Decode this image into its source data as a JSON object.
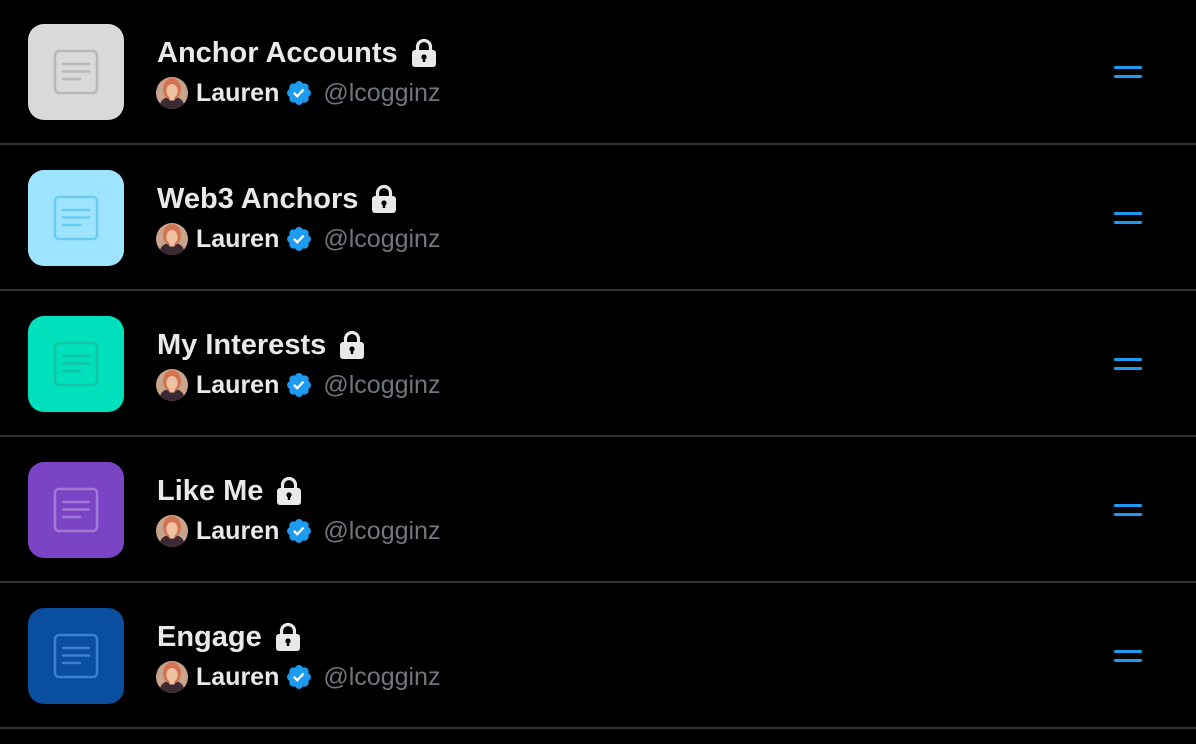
{
  "lists": [
    {
      "title": "Anchor Accounts",
      "owner_name": "Lauren",
      "handle": "@lcogginz",
      "thumb_bg": "#d9d9d9",
      "thumb_icon_color": "#b8b8b8",
      "lock_icon": "lock-icon",
      "verified_icon": "verified-badge-icon",
      "drag_icon": "drag-handle-icon"
    },
    {
      "title": "Web3 Anchors",
      "owner_name": "Lauren",
      "handle": "@lcogginz",
      "thumb_bg": "#9fe4ff",
      "thumb_icon_color": "#6ccbf0",
      "lock_icon": "lock-icon",
      "verified_icon": "verified-badge-icon",
      "drag_icon": "drag-handle-icon"
    },
    {
      "title": "My Interests",
      "owner_name": "Lauren",
      "handle": "@lcogginz",
      "thumb_bg": "#00e0bd",
      "thumb_icon_color": "#14c2a4",
      "lock_icon": "lock-icon",
      "verified_icon": "verified-badge-icon",
      "drag_icon": "drag-handle-icon"
    },
    {
      "title": "Like Me",
      "owner_name": "Lauren",
      "handle": "@lcogginz",
      "thumb_bg": "#7a44c4",
      "thumb_icon_color": "#a07ad8",
      "lock_icon": "lock-icon",
      "verified_icon": "verified-badge-icon",
      "drag_icon": "drag-handle-icon"
    },
    {
      "title": "Engage",
      "owner_name": "Lauren",
      "handle": "@lcogginz",
      "thumb_bg": "#0a4ea0",
      "thumb_icon_color": "#3d7fd0",
      "lock_icon": "lock-icon",
      "verified_icon": "verified-badge-icon",
      "drag_icon": "drag-handle-icon"
    }
  ],
  "colors": {
    "background": "#000000",
    "divider": "#2f3336",
    "primary_text": "#e7e9ea",
    "secondary_text": "#71767b",
    "accent_blue": "#1d9bf0"
  }
}
